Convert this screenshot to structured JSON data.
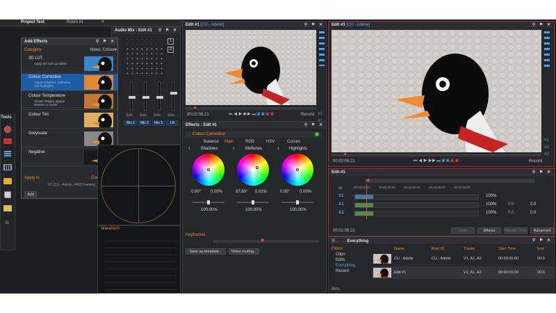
{
  "top_tabs": {
    "project": "Project Test",
    "room": "Room #1"
  },
  "tools_panel": {
    "title": "Tools"
  },
  "add_effects": {
    "title": "Add Effects",
    "category_label": "Category",
    "category_value": "Video, Colour",
    "items": [
      {
        "name": "3D LUT",
        "desc": "Apply 3D look up tables"
      },
      {
        "name": "Colour Correction",
        "desc": "Adjust shadows, midtones and highlights"
      },
      {
        "name": "Colour Temperature",
        "desc": "Shows images appear warmer or cooler"
      },
      {
        "name": "Colour Tint",
        "desc": ""
      },
      {
        "name": "Greyscale",
        "desc": ""
      },
      {
        "name": "Negative",
        "desc": ""
      }
    ],
    "apply_to_label": "Apply to",
    "apply_to_value": "Current Clip",
    "clip_info": "V1 (CU - Adelie, 4492 Frames)",
    "add_button": "Add"
  },
  "audio_mix": {
    "title": "Audio Mix : Edit #1",
    "strips": [
      "Mix 1",
      "Mix 2",
      "Mix 3",
      "LB"
    ],
    "solo_label": "Solo",
    "numbers": [
      "1",
      "2"
    ]
  },
  "waveform": {
    "title": "Waveform"
  },
  "source_viewer": {
    "title": "Edit #1",
    "subtitle": "[CU - Adelie]",
    "timecode": "00:02:08.21",
    "record_label": "Record",
    "tracks": [
      "V1",
      "A1",
      "A2"
    ]
  },
  "record_viewer": {
    "title": "Edit #1",
    "subtitle": "[CU - Adelie]",
    "timecode": "00:02:08.21",
    "record_label": "Record",
    "tracks": [
      "V1",
      "A1",
      "A2"
    ]
  },
  "effects_panel": {
    "title": "Effects : Edit #1",
    "effect_name": "Colour Correction",
    "tabs": [
      "Balance",
      "Main",
      "RGB",
      "HSV",
      "Curves"
    ],
    "active_tab": "Main",
    "wheels": [
      {
        "label": "Shadows",
        "v1": "0.00°",
        "v2": "0.00%",
        "v3": "100.00%"
      },
      {
        "label": "Midtones",
        "v1": "97.60°",
        "v2": "0.01%",
        "v3": "100.00%"
      },
      {
        "label": "Highlights",
        "v1": "0.00°",
        "v2": "0.00%",
        "v3": "100.00%"
      }
    ],
    "keyframes_label": "Keyframes",
    "save_template": "Save as template...",
    "video_routing": "Video routing..."
  },
  "timeline": {
    "title": "Edit #1",
    "timecode": "00:02:08.21",
    "tracks": [
      {
        "name": "V1",
        "pct": "100%"
      },
      {
        "name": "A1",
        "pct": "100%",
        "val": "0.0",
        "val2": "0.0"
      },
      {
        "name": "A2",
        "pct": "100%",
        "val": "0.0",
        "val2": "0.0"
      }
    ],
    "all_label": "All",
    "ruler": [
      "00:00:00:00",
      "00:05:00:00",
      "00:10:00:00",
      "00:15:00:00",
      "00:20:00:00"
    ],
    "buttons": [
      "Undo",
      "Effects",
      "Render (FX)",
      "Advanced"
    ]
  },
  "bins": {
    "title": "Everything",
    "tree": {
      "filters_label": "Filters",
      "items": [
        "Clips",
        "Edits",
        "Everything",
        "Recent"
      ],
      "selected": "Everything",
      "bins_label": "Bins"
    },
    "columns": [
      "Name",
      "Reel ID",
      "Tracks",
      "Start Time",
      "End"
    ],
    "rows": [
      {
        "name": "CU - Adelie",
        "reel": "CU - Adelie",
        "tracks": "V1, A1, A2",
        "start": "00:00:00.00",
        "end": "00:0"
      },
      {
        "name": "Edit #1",
        "reel": "",
        "tracks": "V1, A1, A2",
        "start": "00:00:00.00",
        "end": "00:3"
      }
    ]
  },
  "colors": {
    "accent_orange": "#f08a2a",
    "accent_blue": "#4aa3f0",
    "selection": "#1d5fa6",
    "record_red": "#d83a3a"
  }
}
